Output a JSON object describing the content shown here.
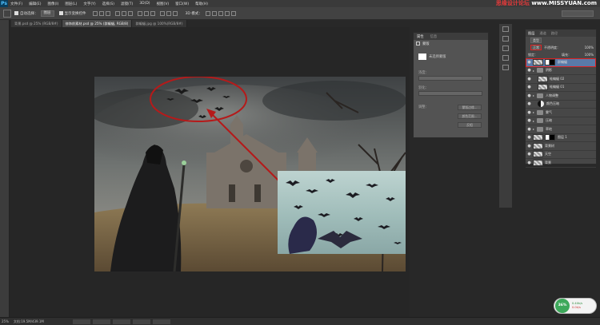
{
  "app": {
    "logo": "Ps"
  },
  "menu": [
    "文件(F)",
    "编辑(E)",
    "图像(I)",
    "图层(L)",
    "文字(Y)",
    "选择(S)",
    "滤镜(T)",
    "3D(D)",
    "视图(V)",
    "窗口(W)",
    "帮助(H)"
  ],
  "brand": {
    "prefix": "思缘设计论坛",
    "site": "www.MISSYUAN.com"
  },
  "options": {
    "auto_select_label": "自动选择：",
    "auto_select_value": "图层",
    "show_transform_label": "显示变换控件",
    "mode_3d": "3D 模式："
  },
  "doc_tabs": [
    {
      "label": "背景.psd @ 25% (RGB/8#)",
      "active": false
    },
    {
      "label": "修饰前素材.psd @ 25% (群蝙蝠, RGB/8)",
      "active": true
    },
    {
      "label": "群蝙蝠.jpg @ 100%(RGB/8#)",
      "active": false
    }
  ],
  "properties": {
    "tabs": [
      "属性",
      "信息"
    ],
    "section": "蒙版",
    "selected_label": "未选择蒙版",
    "density_label": "浓度：",
    "feather_label": "羽化：",
    "refine_label": "调整：",
    "btn_mask_edge": "蒙版边缘...",
    "btn_color_range": "颜色范围...",
    "btn_invert": "反相"
  },
  "layers_panel": {
    "tabs": [
      "图层",
      "通道",
      "路径"
    ],
    "filter_kind": "类型",
    "blend_mode": "正常",
    "opacity_label": "不透明度：",
    "opacity_value": "100%",
    "lock_label": "锁定：",
    "fill_label": "填充：",
    "fill_value": "100%",
    "layers": [
      {
        "name": "群蝙蝠",
        "type": "pixel-mask",
        "active": true,
        "highlight": true,
        "indent": 0
      },
      {
        "name": "阴影",
        "type": "group",
        "active": false,
        "highlight": false,
        "indent": 0
      },
      {
        "name": "蛙蝙蝠 02",
        "type": "pixel",
        "active": false,
        "highlight": false,
        "indent": 1
      },
      {
        "name": "蛙蝙蝠 01",
        "type": "pixel",
        "active": false,
        "highlight": false,
        "indent": 1
      },
      {
        "name": "人物调整",
        "type": "group",
        "active": false,
        "highlight": false,
        "indent": 0
      },
      {
        "name": "颜色压暗",
        "type": "adjust",
        "active": false,
        "highlight": false,
        "indent": 1
      },
      {
        "name": "雾气",
        "type": "group",
        "active": false,
        "highlight": false,
        "indent": 0
      },
      {
        "name": "压暗",
        "type": "group",
        "active": false,
        "highlight": false,
        "indent": 0
      },
      {
        "name": "草地",
        "type": "group",
        "active": false,
        "highlight": false,
        "indent": 0
      },
      {
        "name": "图层 1",
        "type": "pixel-mask",
        "active": false,
        "highlight": false,
        "indent": 0
      },
      {
        "name": "背景树",
        "type": "pixel",
        "active": false,
        "highlight": false,
        "indent": 0
      },
      {
        "name": "天空",
        "type": "pixel",
        "active": false,
        "highlight": false,
        "indent": 0
      },
      {
        "name": "背景",
        "type": "pixel",
        "active": false,
        "highlight": false,
        "indent": 0
      }
    ]
  },
  "status": {
    "zoom": "25%",
    "doc_label": "文档:19.5M/439.1M"
  },
  "perf": {
    "gauge": "36%",
    "up": "0.40k/s",
    "down": "0.0k/s"
  }
}
